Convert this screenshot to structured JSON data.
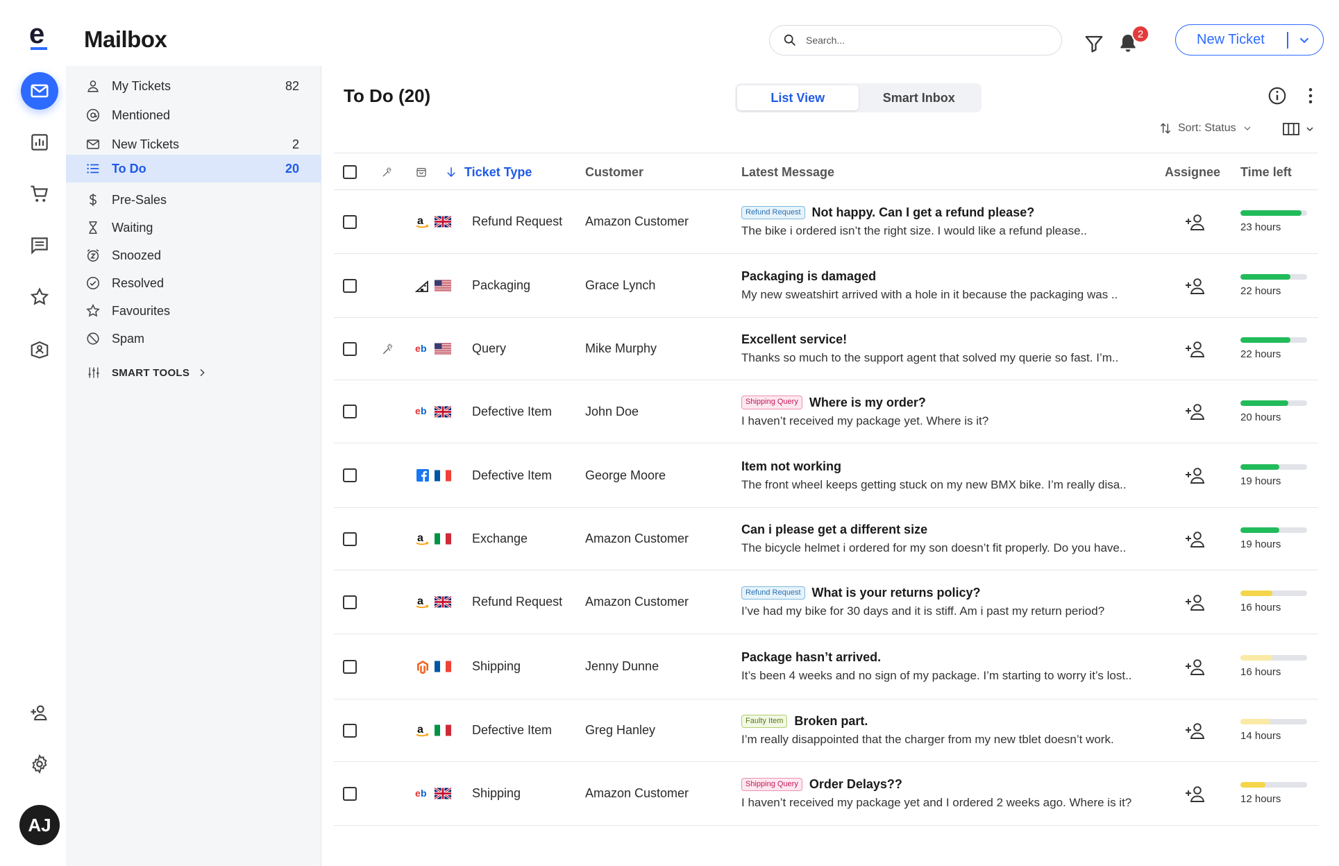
{
  "app": {
    "title": "Mailbox",
    "logo_letter": "e"
  },
  "header": {
    "search_placeholder": "Search...",
    "notifications_count": "2",
    "new_ticket_label": "New Ticket"
  },
  "user": {
    "initials": "AJ"
  },
  "rail": {
    "items": [
      {
        "icon": "mail-icon",
        "active": true
      },
      {
        "icon": "bar-chart-icon",
        "active": false
      },
      {
        "icon": "cart-icon",
        "active": false
      },
      {
        "icon": "message-icon",
        "active": false
      },
      {
        "icon": "star-icon",
        "active": false
      },
      {
        "icon": "book-user-icon",
        "active": false
      }
    ],
    "bottom": [
      {
        "icon": "add-user-icon"
      },
      {
        "icon": "gear-icon"
      }
    ]
  },
  "sidebar": {
    "items": [
      {
        "label": "My Tickets",
        "count": "82",
        "icon": "user-icon"
      },
      {
        "label": "Mentioned",
        "count": "",
        "icon": "at-icon"
      },
      {
        "label": "New Tickets",
        "count": "2",
        "icon": "envelope-icon"
      },
      {
        "label": "To Do",
        "count": "20",
        "icon": "list-icon",
        "active": true
      },
      {
        "label": "Pre-Sales",
        "count": "",
        "icon": "dollar-icon"
      },
      {
        "label": "Waiting",
        "count": "",
        "icon": "hourglass-icon"
      },
      {
        "label": "Snoozed",
        "count": "",
        "icon": "snooze-icon"
      },
      {
        "label": "Resolved",
        "count": "",
        "icon": "check-circle-icon"
      },
      {
        "label": "Favourites",
        "count": "",
        "icon": "star-icon"
      },
      {
        "label": "Spam",
        "count": "",
        "icon": "block-icon"
      }
    ],
    "smart_tools_label": "SMART TOOLS"
  },
  "main": {
    "title": "To Do (20)",
    "view_options": [
      "List View",
      "Smart Inbox"
    ],
    "active_view": "List View",
    "sort_label": "Sort: Status",
    "columns": {
      "ticket_type": "Ticket Type",
      "customer": "Customer",
      "latest_message": "Latest Message",
      "assignee": "Assignee",
      "time_left": "Time left"
    }
  },
  "colors": {
    "accent": "#2d6bff",
    "green": "#22bb5b",
    "yellow": "#f5d54a",
    "light_yellow": "#faeaa5"
  },
  "tickets": [
    {
      "magic": false,
      "channel": "amazon",
      "flag": "uk",
      "type": "Refund Request",
      "customer": "Amazon Customer",
      "tag": "Refund Request",
      "tag_color": "blue",
      "title": "Not happy. Can I get a refund please?",
      "preview": "The bike i ordered isn’t the right size. I would like a refund please..",
      "time": "23 hours",
      "progress": 0.92,
      "bar_color": "green"
    },
    {
      "magic": false,
      "channel": "store",
      "flag": "us",
      "type": "Packaging",
      "customer": "Grace Lynch",
      "tag": "",
      "tag_color": "",
      "title": "Packaging is damaged",
      "preview": "My new sweatshirt arrived with a hole in it because the packaging was ..",
      "time": "22 hours",
      "progress": 0.75,
      "bar_color": "green"
    },
    {
      "magic": true,
      "channel": "ebay",
      "flag": "us",
      "type": "Query",
      "customer": "Mike Murphy",
      "tag": "",
      "tag_color": "",
      "title": "Excellent service!",
      "preview": "Thanks so much to the support agent that solved my querie so fast. I’m..",
      "time": "22 hours",
      "progress": 0.75,
      "bar_color": "green"
    },
    {
      "magic": false,
      "channel": "ebay",
      "flag": "uk",
      "type": "Defective Item",
      "customer": "John Doe",
      "tag": "Shipping Query",
      "tag_color": "pink",
      "title": "Where is my order?",
      "preview": "I haven’t received my package yet. Where is it?",
      "time": "20 hours",
      "progress": 0.72,
      "bar_color": "green"
    },
    {
      "magic": false,
      "channel": "facebook",
      "flag": "fr",
      "type": "Defective Item",
      "customer": "George Moore",
      "tag": "",
      "tag_color": "",
      "title": "Item not working",
      "preview": "The front wheel keeps getting stuck on my new BMX bike. I’m really disa..",
      "time": "19 hours",
      "progress": 0.58,
      "bar_color": "green"
    },
    {
      "magic": false,
      "channel": "amazon",
      "flag": "it",
      "type": "Exchange",
      "customer": "Amazon Customer",
      "tag": "",
      "tag_color": "",
      "title": "Can i please get a different size",
      "preview": "The bicycle helmet i ordered for my son doesn’t fit properly. Do you have..",
      "time": "19 hours",
      "progress": 0.58,
      "bar_color": "green"
    },
    {
      "magic": false,
      "channel": "amazon",
      "flag": "uk",
      "type": "Refund Request",
      "customer": "Amazon Customer",
      "tag": "Refund Request",
      "tag_color": "blue",
      "title": "What is your returns policy?",
      "preview": "I’ve had my bike for 30 days and it is stiff. Am i past my return period?",
      "time": "16 hours",
      "progress": 0.48,
      "bar_color": "yellow"
    },
    {
      "magic": false,
      "channel": "magento",
      "flag": "fr",
      "type": "Shipping",
      "customer": "Jenny Dunne",
      "tag": "",
      "tag_color": "",
      "title": "Package hasn’t arrived.",
      "preview": "It’s been 4 weeks and no sign of my package. I’m starting to worry it’s lost..",
      "time": "16 hours",
      "progress": 0.48,
      "bar_color": "light_yellow"
    },
    {
      "magic": false,
      "channel": "amazon",
      "flag": "it",
      "type": "Defective Item",
      "customer": "Greg Hanley",
      "tag": "Faulty Item",
      "tag_color": "green",
      "title": "Broken part.",
      "preview": "I’m really disappointed that the charger from my new tblet doesn’t  work.",
      "time": "14 hours",
      "progress": 0.45,
      "bar_color": "light_yellow"
    },
    {
      "magic": false,
      "channel": "ebay",
      "flag": "uk",
      "type": "Shipping",
      "customer": "Amazon Customer",
      "tag": "Shipping Query",
      "tag_color": "pink",
      "title": "Order Delays??",
      "preview": "I haven’t received my package yet and I ordered 2 weeks ago. Where is it?",
      "time": "12 hours",
      "progress": 0.38,
      "bar_color": "yellow"
    }
  ]
}
